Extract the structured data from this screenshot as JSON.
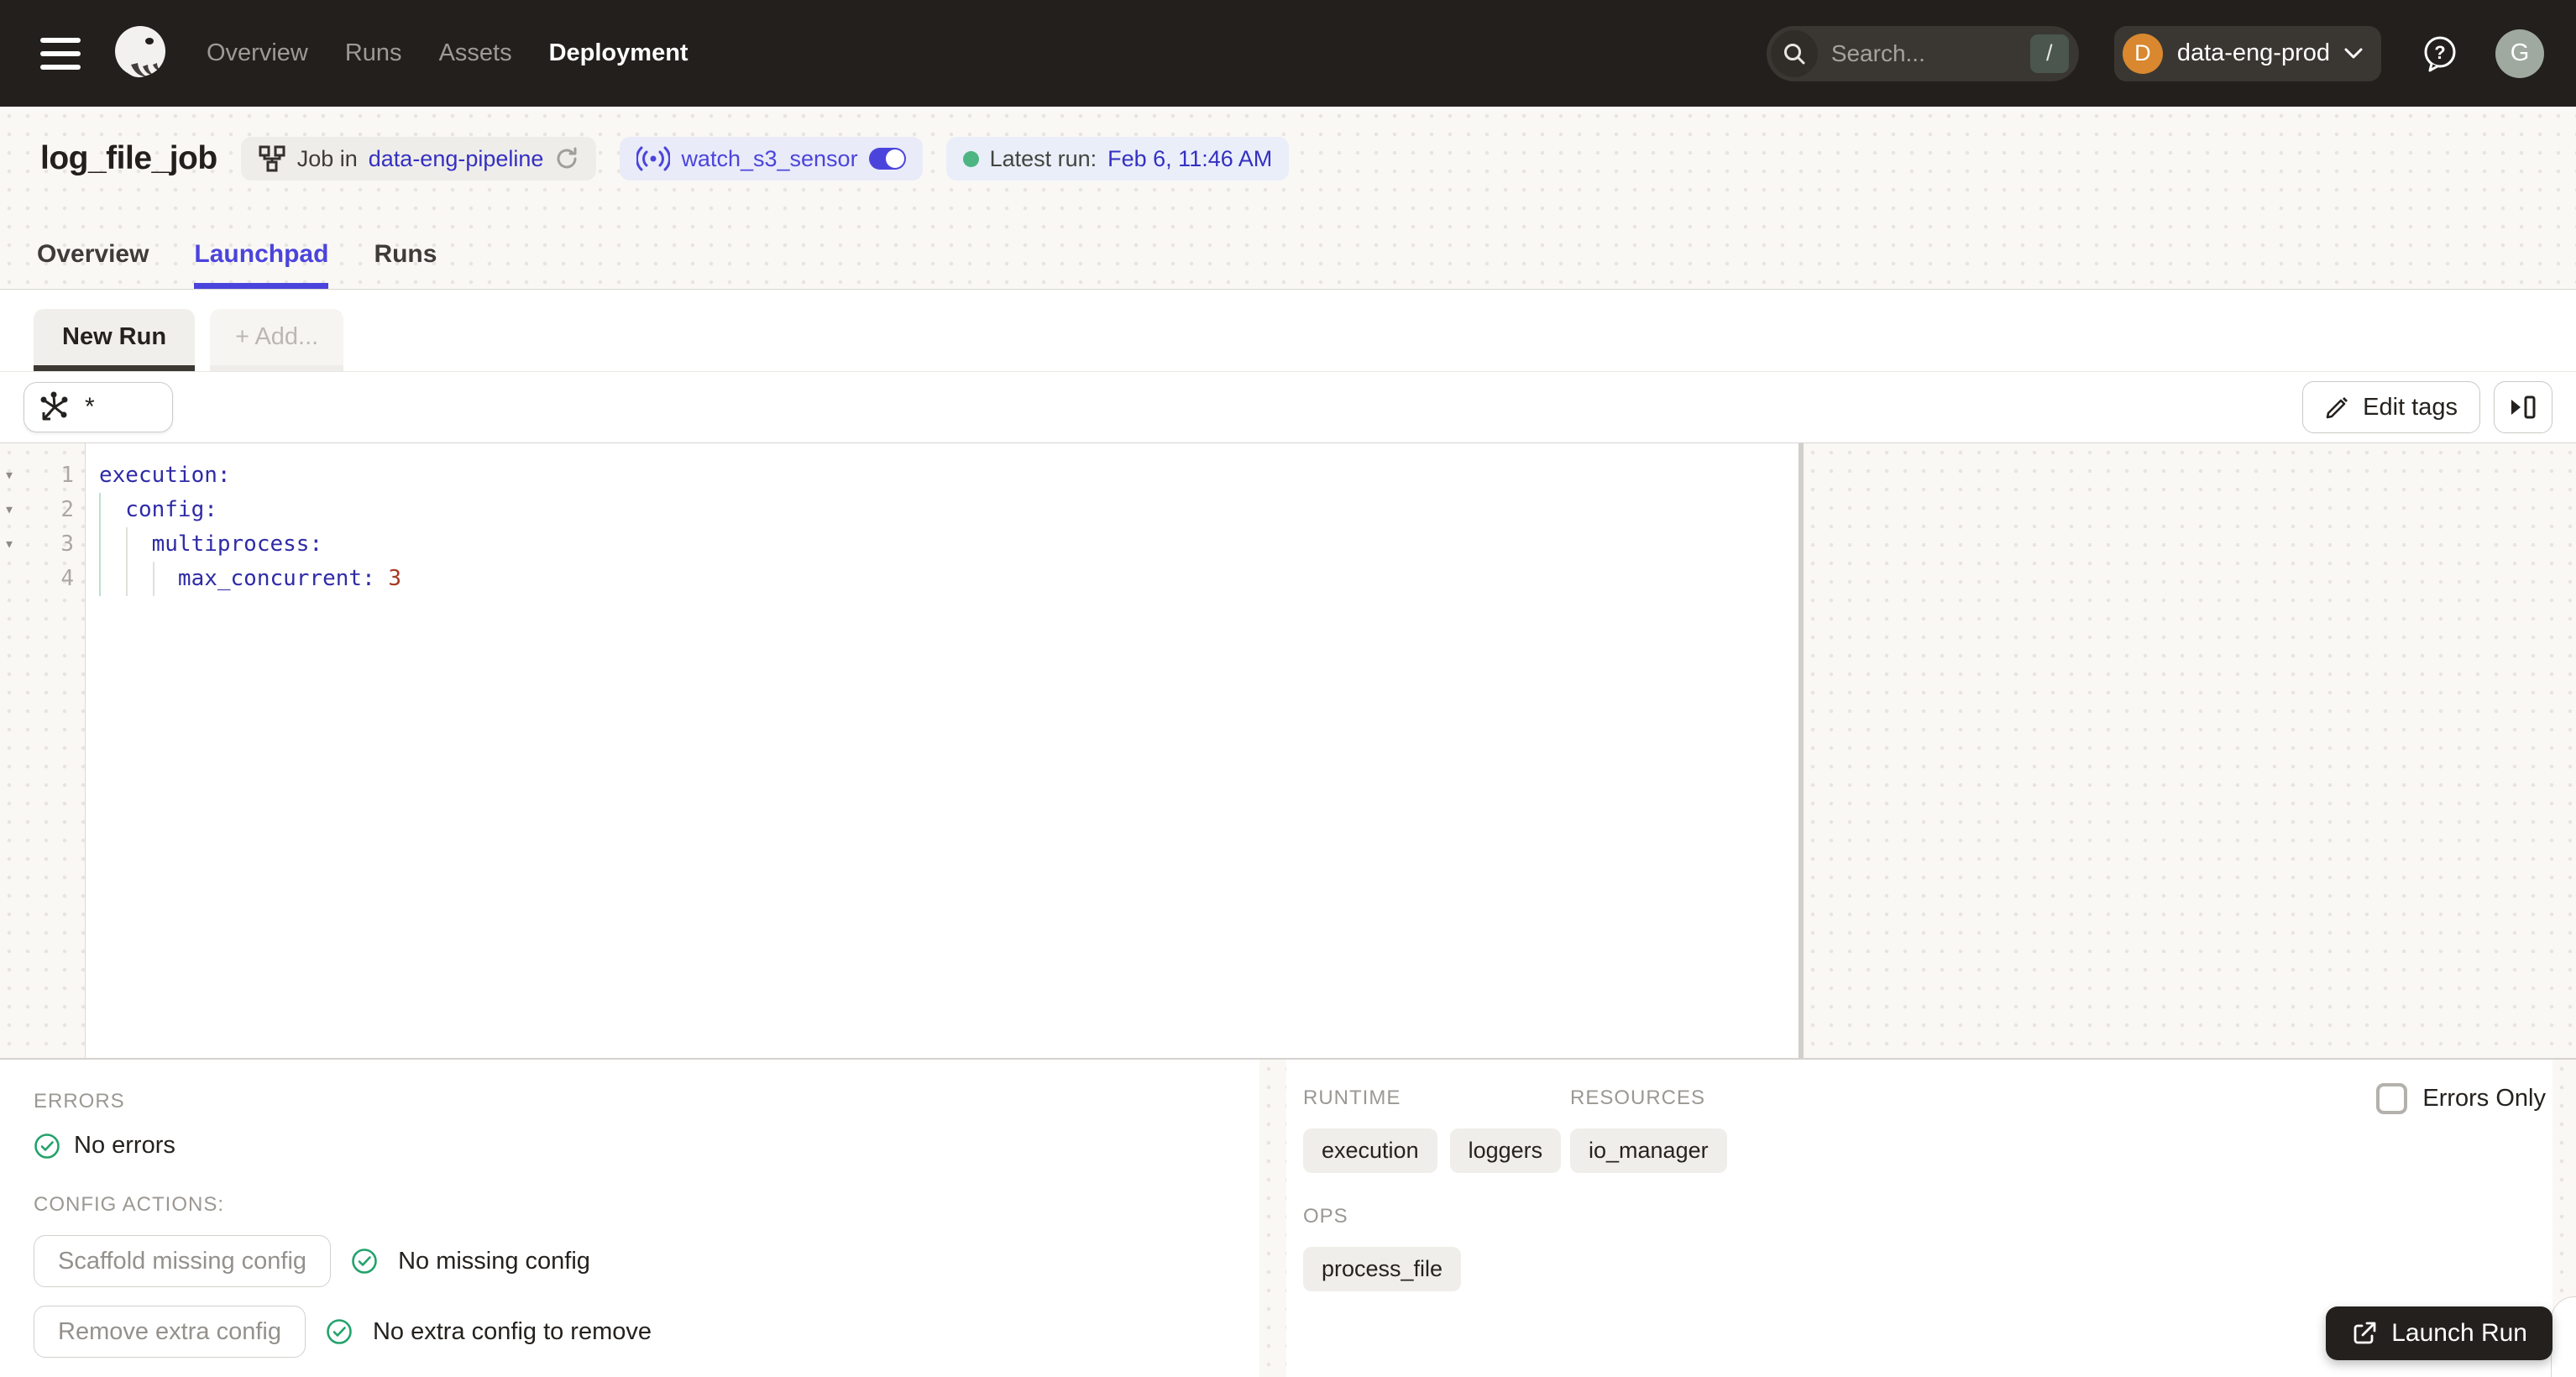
{
  "topnav": {
    "nav": [
      {
        "label": "Overview"
      },
      {
        "label": "Runs"
      },
      {
        "label": "Assets"
      },
      {
        "label": "Deployment"
      }
    ],
    "search": {
      "placeholder": "Search...",
      "shortcut": "/"
    },
    "deployment_switcher": {
      "initial": "D",
      "name": "data-eng-prod"
    },
    "user_initial": "G"
  },
  "header": {
    "title": "log_file_job",
    "job_badge": {
      "prefix": "Job in",
      "link": "data-eng-pipeline"
    },
    "sensor_badge": {
      "name": "watch_s3_sensor"
    },
    "latest_run": {
      "label": "Latest run:",
      "value": "Feb 6, 11:46 AM"
    },
    "tabs": [
      {
        "label": "Overview"
      },
      {
        "label": "Launchpad"
      },
      {
        "label": "Runs"
      }
    ]
  },
  "launchpad": {
    "session_tab": "New Run",
    "add_tab": "+ Add...",
    "op_selector": "*",
    "edit_tags": "Edit tags",
    "editor": {
      "lines": [
        {
          "num": "1",
          "code": "execution:",
          "value": ""
        },
        {
          "num": "2",
          "code": "  config:",
          "value": ""
        },
        {
          "num": "3",
          "code": "    multiprocess:",
          "value": ""
        },
        {
          "num": "4",
          "code": "      max_concurrent:",
          "value": " 3"
        }
      ]
    }
  },
  "bottom": {
    "errors_label": "ERRORS",
    "no_errors": "No errors",
    "config_actions_label": "CONFIG ACTIONS:",
    "scaffold_button": "Scaffold missing config",
    "no_missing": "No missing config",
    "remove_button": "Remove extra config",
    "no_extra": "No extra config to remove",
    "errors_only": "Errors Only",
    "runtime_label": "RUNTIME",
    "runtime_chips": [
      {
        "label": "execution"
      },
      {
        "label": "loggers"
      }
    ],
    "resources_label": "RESOURCES",
    "resources_chips": [
      {
        "label": "io_manager"
      }
    ],
    "ops_label": "OPS",
    "ops_chips": [
      {
        "label": "process_file"
      }
    ],
    "launch_run": "Launch Run"
  },
  "colors": {
    "accent": "#4B44DC",
    "link": "#3430C2",
    "green": "#23A26B",
    "avatar_orange": "#D9882F"
  }
}
